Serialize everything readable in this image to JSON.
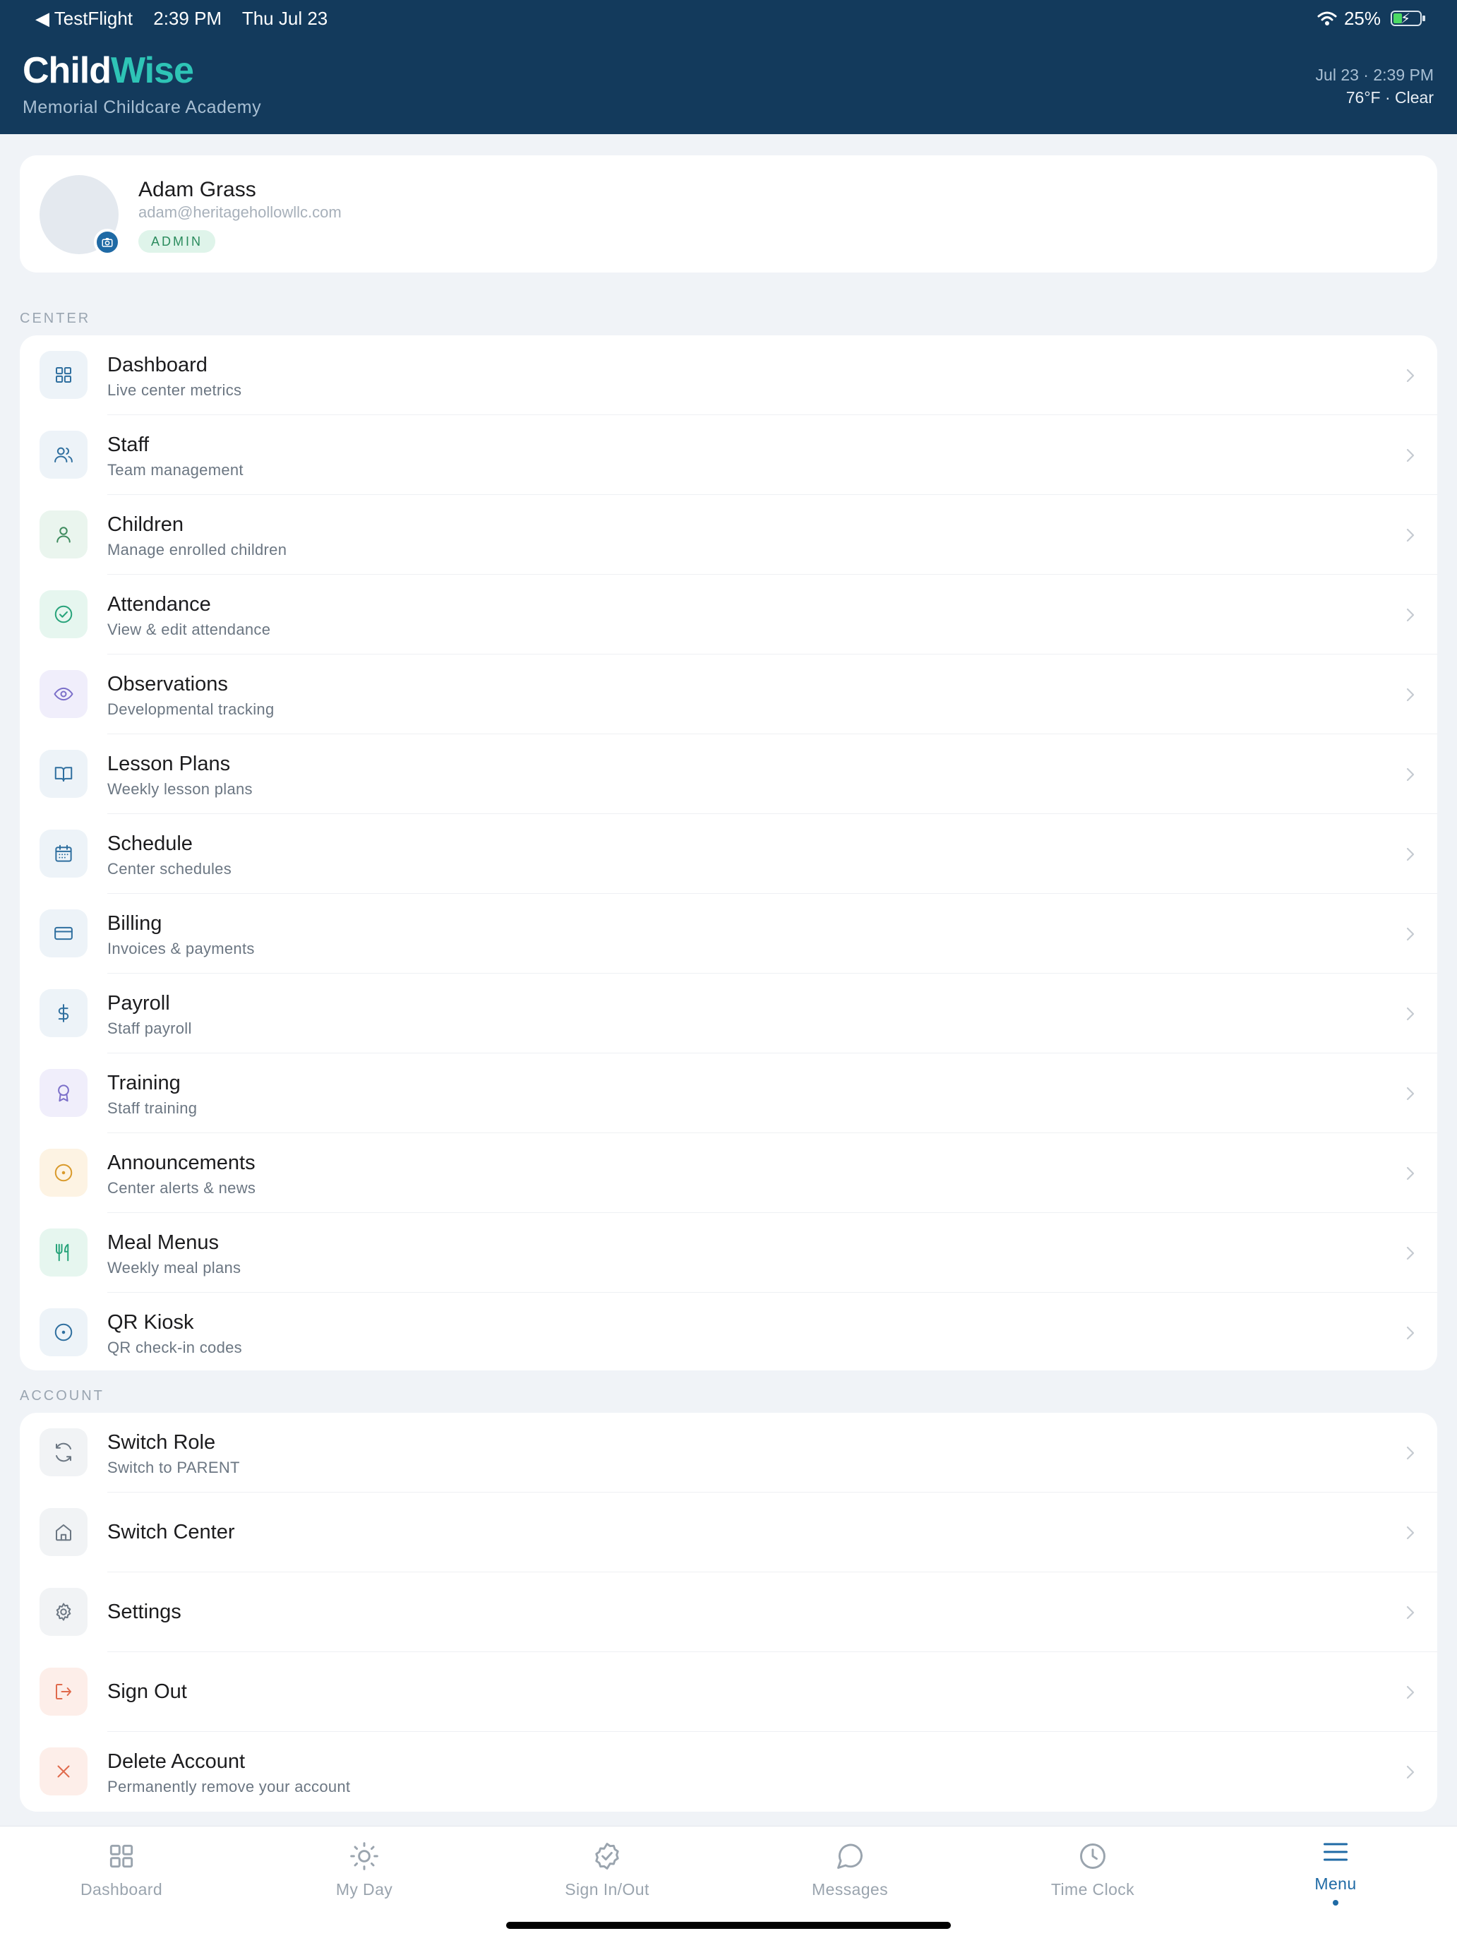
{
  "status_bar": {
    "back_app": "◀ TestFlight",
    "time": "2:39 PM",
    "date": "Thu Jul 23",
    "battery": "25%"
  },
  "header": {
    "brand_part1": "Child",
    "brand_part2": "Wise",
    "center_name": "Memorial Childcare Academy",
    "datetime": "Jul 23 · 2:39 PM",
    "weather": "76°F · Clear"
  },
  "profile": {
    "name": "Adam Grass",
    "email": "adam@heritagehollowllc.com",
    "role_badge": "ADMIN"
  },
  "center_section": {
    "label": "CENTER",
    "items": [
      {
        "title": "Dashboard",
        "subtitle": "Live center metrics",
        "icon": "grid-icon",
        "color": "#2f6f9f",
        "bg": "#edf3f8"
      },
      {
        "title": "Staff",
        "subtitle": "Team management",
        "icon": "users-icon",
        "color": "#2f6f9f",
        "bg": "#edf3f8"
      },
      {
        "title": "Children",
        "subtitle": "Manage enrolled children",
        "icon": "user-icon",
        "color": "#3e8b5e",
        "bg": "#eaf5ee"
      },
      {
        "title": "Attendance",
        "subtitle": "View & edit attendance",
        "icon": "check-circle-icon",
        "color": "#27a37a",
        "bg": "#e6f6ef"
      },
      {
        "title": "Observations",
        "subtitle": "Developmental tracking",
        "icon": "eye-icon",
        "color": "#7b6fc9",
        "bg": "#f0eefb"
      },
      {
        "title": "Lesson Plans",
        "subtitle": "Weekly lesson plans",
        "icon": "book-open-icon",
        "color": "#2f6f9f",
        "bg": "#edf3f8"
      },
      {
        "title": "Schedule",
        "subtitle": "Center schedules",
        "icon": "calendar-icon",
        "color": "#2f6f9f",
        "bg": "#edf3f8"
      },
      {
        "title": "Billing",
        "subtitle": "Invoices & payments",
        "icon": "credit-card-icon",
        "color": "#2f6f9f",
        "bg": "#edf3f8"
      },
      {
        "title": "Payroll",
        "subtitle": "Staff payroll",
        "icon": "dollar-icon",
        "color": "#2f6f9f",
        "bg": "#edf3f8"
      },
      {
        "title": "Training",
        "subtitle": "Staff training",
        "icon": "award-icon",
        "color": "#7b6fc9",
        "bg": "#f0eefb"
      },
      {
        "title": "Announcements",
        "subtitle": "Center alerts & news",
        "icon": "target-icon",
        "color": "#d99a2b",
        "bg": "#fdf3e3"
      },
      {
        "title": "Meal Menus",
        "subtitle": "Weekly meal plans",
        "icon": "utensils-icon",
        "color": "#27a37a",
        "bg": "#e6f6ef"
      },
      {
        "title": "QR Kiosk",
        "subtitle": "QR check-in codes",
        "icon": "target-icon",
        "color": "#2f6f9f",
        "bg": "#edf3f8"
      }
    ]
  },
  "account_section": {
    "label": "ACCOUNT",
    "items": [
      {
        "title": "Switch Role",
        "subtitle": "Switch to PARENT",
        "icon": "refresh-icon",
        "color": "#6b7682",
        "bg": "#f1f3f5"
      },
      {
        "title": "Switch Center",
        "subtitle": "",
        "icon": "home-icon",
        "color": "#6b7682",
        "bg": "#f1f3f5"
      },
      {
        "title": "Settings",
        "subtitle": "",
        "icon": "gear-icon",
        "color": "#6b7682",
        "bg": "#f1f3f5"
      },
      {
        "title": "Sign Out",
        "subtitle": "",
        "icon": "sign-out-icon",
        "color": "#e06a4c",
        "bg": "#fdeee9"
      },
      {
        "title": "Delete Account",
        "subtitle": "Permanently remove your account",
        "icon": "close-icon",
        "color": "#e06a4c",
        "bg": "#fdeee9"
      }
    ]
  },
  "tab_bar": {
    "items": [
      {
        "label": "Dashboard",
        "icon": "grid-icon"
      },
      {
        "label": "My Day",
        "icon": "sun-icon"
      },
      {
        "label": "Sign In/Out",
        "icon": "badge-check-icon"
      },
      {
        "label": "Messages",
        "icon": "chat-icon"
      },
      {
        "label": "Time Clock",
        "icon": "clock-icon"
      },
      {
        "label": "Menu",
        "icon": "menu-icon",
        "active": true
      }
    ]
  }
}
